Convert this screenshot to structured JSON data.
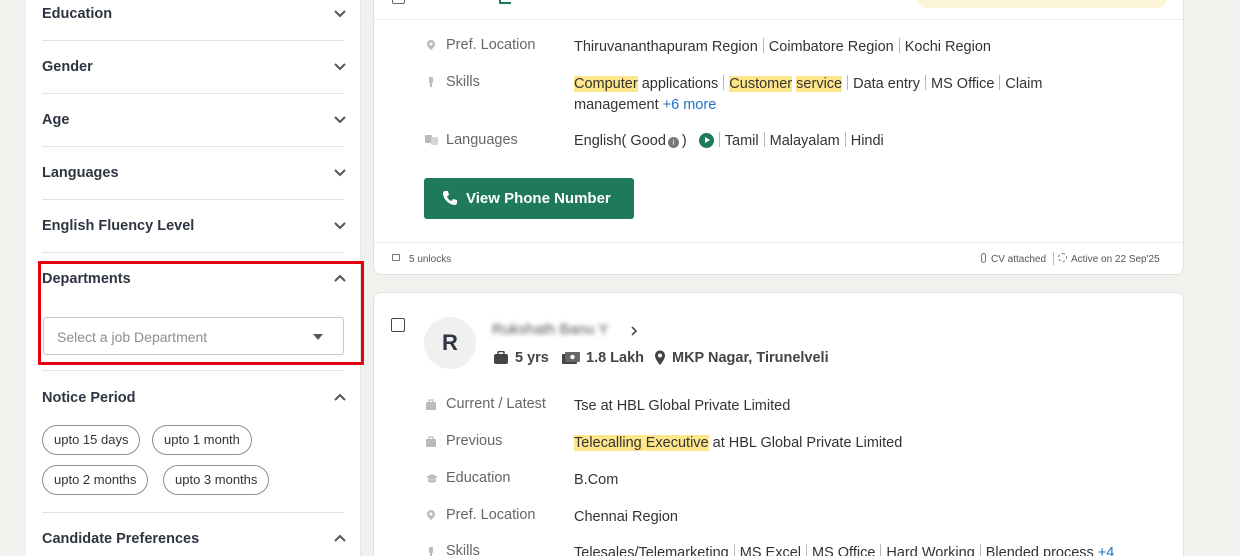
{
  "filters": {
    "education": "Education",
    "gender": "Gender",
    "age": "Age",
    "languages": "Languages",
    "english_fluency": "English Fluency Level",
    "departments": "Departments",
    "department_placeholder": "Select a job Department",
    "notice_period": "Notice Period",
    "notice_options": [
      "upto 15 days",
      "upto 1 month",
      "upto 2 months",
      "upto 3 months"
    ],
    "candidate_preferences": "Candidate Preferences"
  },
  "card1": {
    "pref_location_label": "Pref. Location",
    "locations": [
      "Thiruvananthapuram Region",
      "Coimbatore Region",
      "Kochi Region"
    ],
    "skills_label": "Skills",
    "skills": [
      "Computer",
      "applications",
      "Customer",
      "service",
      "Data entry",
      "MS Office",
      "Claim",
      "management"
    ],
    "skills_more": "+6 more",
    "languages_label": "Languages",
    "english": "English( Good",
    "english_close": ")",
    "other_languages": [
      "Tamil",
      "Malayalam",
      "Hindi"
    ],
    "view_phone": "View Phone Number",
    "unlocks": "5 unlocks",
    "cv": "CV attached",
    "active": "Active on 22 Sep'25"
  },
  "card2": {
    "avatar_letter": "R",
    "name": "Rukshath Banu Y",
    "experience": "5 yrs",
    "salary": "1.8 Lakh",
    "location": "MKP Nagar, Tirunelveli",
    "current_label": "Current / Latest",
    "current_value": "Tse at HBL Global Private Limited",
    "previous_label": "Previous",
    "previous_highlight": "Telecalling Executive",
    "previous_rest": " at HBL Global Private Limited",
    "education_label": "Education",
    "education_value": "B.Com",
    "pref_location_label": "Pref. Location",
    "pref_location_value": "Chennai Region",
    "skills_label": "Skills",
    "skills": [
      "Telesales/Telemarketing",
      "MS Excel",
      "MS Office",
      "Hard Working",
      "Blended process"
    ],
    "skills_more": "+4"
  }
}
